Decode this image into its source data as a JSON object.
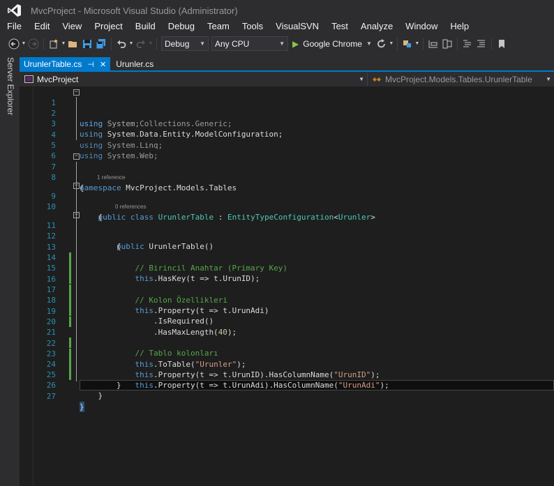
{
  "window": {
    "title": "MvcProject - Microsoft Visual Studio (Administrator)"
  },
  "menu": [
    "File",
    "Edit",
    "View",
    "Project",
    "Build",
    "Debug",
    "Team",
    "Tools",
    "VisualSVN",
    "Test",
    "Analyze",
    "Window",
    "Help"
  ],
  "toolbar": {
    "config": "Debug",
    "platform": "Any CPU",
    "run_target": "Google Chrome"
  },
  "side_panel": {
    "label": "Server Explorer"
  },
  "tabs": [
    {
      "label": "UrunlerTable.cs",
      "active": true
    },
    {
      "label": "Urunler.cs",
      "active": false
    }
  ],
  "navbar": {
    "project": "MvcProject",
    "member": "MvcProject.Models.Tables.UrunlerTable"
  },
  "codelens": {
    "ref1": "1 reference",
    "ref0": "0 references"
  },
  "editor": {
    "line_numbers": [
      "1",
      "2",
      "3",
      "4",
      "5",
      "6",
      "7",
      "8",
      "9",
      "10",
      "11",
      "12",
      "13",
      "14",
      "15",
      "16",
      "17",
      "18",
      "19",
      "20",
      "21",
      "22",
      "23",
      "24",
      "25",
      "26",
      "27"
    ],
    "code": {
      "l1_kw": "using",
      "l1_rest": " System;",
      "l2_kw": "using",
      "l2_rest": " System.Collections.Generic;",
      "l3_kw": "using",
      "l3_rest": " System.Data.Entity.ModelConfiguration;",
      "l4_kw": "using",
      "l4_rest": " System.Linq;",
      "l5_kw": "using",
      "l5_rest": " System.Web;",
      "l7_kw": "namespace",
      "l7_rest": " MvcProject.Models.Tables",
      "l8": "{",
      "l9_kw": "public class",
      "l9_ty": "UrunlerTable",
      "l9_mid": " : ",
      "l9_ty2": "EntityTypeConfiguration",
      "l9_lt": "<",
      "l9_ty3": "Urunler",
      "l9_gt": ">",
      "l10": "{",
      "l11_kw": "public",
      "l11_rest": " UrunlerTable()",
      "l12": "{",
      "l13_cm": "// Birincil Anahtar (Primary Key)",
      "l14_kw": "this",
      "l14_rest": ".HasKey(t => t.UrunID);",
      "l16_cm": "// Kolon Özellikleri",
      "l17_kw": "this",
      "l17_rest": ".Property(t => t.UrunAdi)",
      "l18": ".IsRequired()",
      "l19_a": ".HasMaxLength(",
      "l19_num": "40",
      "l19_b": ");",
      "l21_cm": "// Tablo kolonları",
      "l22_kw": "this",
      "l22_a": ".ToTable(",
      "l22_st": "\"Urunler\"",
      "l22_b": ");",
      "l23_kw": "this",
      "l23_a": ".Property(t => t.UrunID).HasColumnName(",
      "l23_st": "\"UrunID\"",
      "l23_b": ");",
      "l24_kw": "this",
      "l24_a": ".Property(t => t.UrunAdi).HasColumnName(",
      "l24_st": "\"UrunAdi\"",
      "l24_b": ");",
      "l25": "}",
      "l26": "}",
      "l27": "}"
    }
  }
}
